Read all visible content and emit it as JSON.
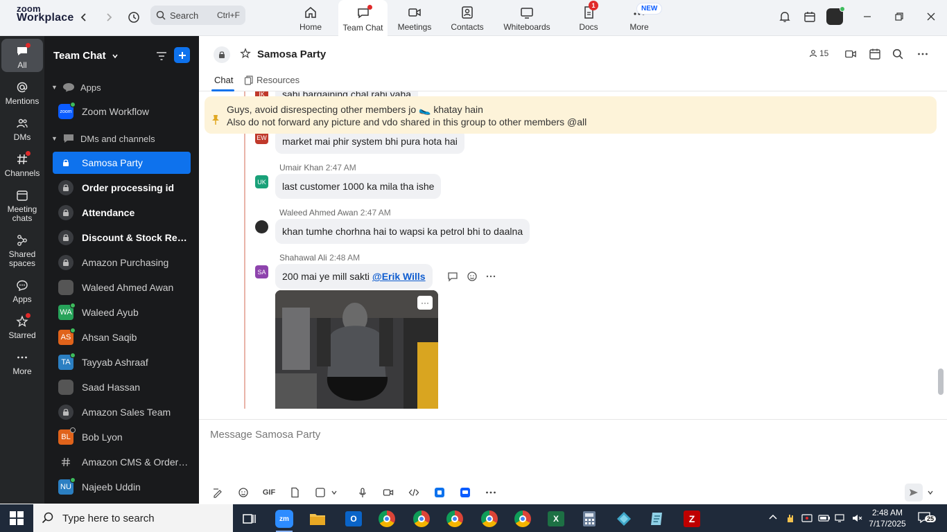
{
  "app": {
    "logo_line1": "zoom",
    "logo_line2": "Workplace"
  },
  "search": {
    "placeholder": "Search",
    "shortcut": "Ctrl+F"
  },
  "top_nav": [
    {
      "label": "Home",
      "icon": "home-icon"
    },
    {
      "label": "Team Chat",
      "icon": "chat-icon",
      "active": true
    },
    {
      "label": "Meetings",
      "icon": "video-icon"
    },
    {
      "label": "Contacts",
      "icon": "contacts-icon"
    },
    {
      "label": "Whiteboards",
      "icon": "whiteboard-icon"
    },
    {
      "label": "Docs",
      "icon": "docs-icon",
      "badge": "1"
    },
    {
      "label": "More",
      "icon": "more-icon",
      "badge": "NEW"
    }
  ],
  "rail": [
    {
      "label": "All",
      "icon": "chat-bubble-icon",
      "active": true
    },
    {
      "label": "Mentions",
      "icon": "at-icon"
    },
    {
      "label": "DMs",
      "icon": "people-icon"
    },
    {
      "label": "Channels",
      "icon": "hash-icon"
    },
    {
      "label": "Meeting chats",
      "icon": "calendar-icon"
    },
    {
      "label": "Shared spaces",
      "icon": "share-icon"
    },
    {
      "label": "Apps",
      "icon": "apps-bubble-icon"
    },
    {
      "label": "Starred",
      "icon": "star-icon"
    },
    {
      "label": "More",
      "icon": "ellipsis-icon"
    }
  ],
  "sidebar": {
    "title": "Team Chat",
    "sections": {
      "apps": "Apps",
      "dms": "DMs and channels"
    },
    "app_item": "Zoom Workflow",
    "app_item_avatar": "zoom",
    "items": [
      {
        "label": "Samosa Party",
        "type": "channel",
        "selected": true
      },
      {
        "label": "Order processing id",
        "type": "channel",
        "bold": true
      },
      {
        "label": "Attendance",
        "type": "channel",
        "bold": true
      },
      {
        "label": "Discount & Stock Res...",
        "type": "channel",
        "bold": true
      },
      {
        "label": "Amazon Purchasing",
        "type": "channel"
      },
      {
        "label": "Waleed Ahmed Awan",
        "type": "photo"
      },
      {
        "label": "Waleed Ayub",
        "type": "user",
        "initials": "WA",
        "color": "#27a35a",
        "status": "online"
      },
      {
        "label": "Ahsan Saqib",
        "type": "user",
        "initials": "AS",
        "color": "#e0631b",
        "status": "online"
      },
      {
        "label": "Tayyab Ashraaf",
        "type": "user",
        "initials": "TA",
        "color": "#2b7fc2",
        "status": "online"
      },
      {
        "label": "Saad Hassan",
        "type": "photo"
      },
      {
        "label": "Amazon Sales Team",
        "type": "channel"
      },
      {
        "label": "Bob Lyon",
        "type": "user",
        "initials": "BL",
        "color": "#e0631b",
        "status": "offline"
      },
      {
        "label": "Amazon CMS & OrderA...",
        "type": "hash"
      },
      {
        "label": "Najeeb Uddin",
        "type": "user",
        "initials": "NU",
        "color": "#2b7fc2",
        "status": "online"
      }
    ]
  },
  "channel": {
    "title": "Samosa Party",
    "member_count": "15",
    "tabs": [
      "Chat",
      "Resources"
    ]
  },
  "pinned": {
    "line1": "Guys, avoid disrespecting other members jo 🥿 khatay hain",
    "line2": "Also do not forward any picture and vdo shared in this group to other members @all"
  },
  "messages": [
    {
      "avatar": "EW",
      "color": "#c0392b",
      "text": "market mai phir system bhi pura hota hai"
    },
    {
      "sender": "Umair Khan",
      "time": "2:47 AM",
      "avatar": "UK",
      "color": "#1aa179",
      "text": "last customer 1000 ka mila tha ishe"
    },
    {
      "sender": "Waleed Ahmed Awan",
      "time": "2:47 AM",
      "avatar": "",
      "color": "#333",
      "text": "khan tumhe chorhna hai to wapsi ka petrol bhi to daalna"
    },
    {
      "sender": "Shahawal Ali",
      "time": "2:48 AM",
      "avatar": "SA",
      "color": "#8e44ad",
      "text": "200 mai ye mill sakti",
      "mention": "@Erik Wills"
    }
  ],
  "partial_top_text": "sahi bargaining chal rahi yaha",
  "partial_top_avatar": "IK",
  "composer": {
    "placeholder": "Message Samosa Party",
    "gif_label": "GIF"
  },
  "taskbar": {
    "search_placeholder": "Type here to search",
    "time": "2:48 AM",
    "date": "7/17/2025",
    "notifications": "25",
    "zoom_label": "zm"
  }
}
